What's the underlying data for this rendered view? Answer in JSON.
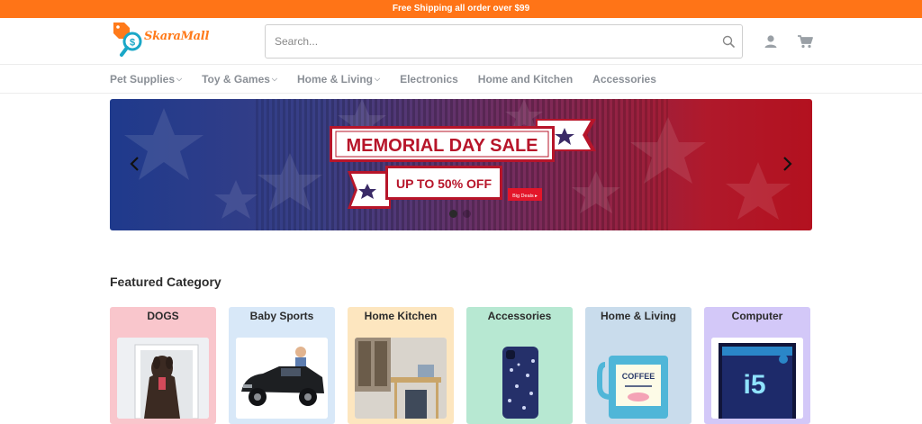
{
  "topbar": {
    "text": "Free Shipping all order over $99"
  },
  "header": {
    "logo_text": "SkaraMall",
    "search_placeholder": "Search..."
  },
  "nav": {
    "items": [
      {
        "label": "Pet Supplies",
        "has_dropdown": true
      },
      {
        "label": "Toy & Games",
        "has_dropdown": true
      },
      {
        "label": "Home & Living",
        "has_dropdown": true
      },
      {
        "label": "Electronics",
        "has_dropdown": false
      },
      {
        "label": "Home and Kitchen",
        "has_dropdown": false
      },
      {
        "label": "Accessories",
        "has_dropdown": false
      }
    ]
  },
  "banner": {
    "headline": "MEMORIAL DAY SALE",
    "subline": "UP TO 50% OFF",
    "tag": "Big Deals ▸",
    "slides": 2,
    "active_slide": 1
  },
  "featured": {
    "title": "Featured Category",
    "cards": [
      {
        "title": "DOGS",
        "bg": "#f9c6cc"
      },
      {
        "title": "Baby Sports",
        "bg": "#d8e8f8"
      },
      {
        "title": "Home Kitchen",
        "bg": "#fde6bf"
      },
      {
        "title": "Accessories",
        "bg": "#b7e8d2"
      },
      {
        "title": "Home & Living",
        "bg": "#c9dcec"
      },
      {
        "title": "Computer",
        "bg": "#d3c8f8"
      }
    ]
  },
  "colors": {
    "accent": "#ff7417",
    "nav_text": "#8a8f96",
    "banner_red": "#b3111f",
    "banner_blue": "#1f3a8c"
  }
}
